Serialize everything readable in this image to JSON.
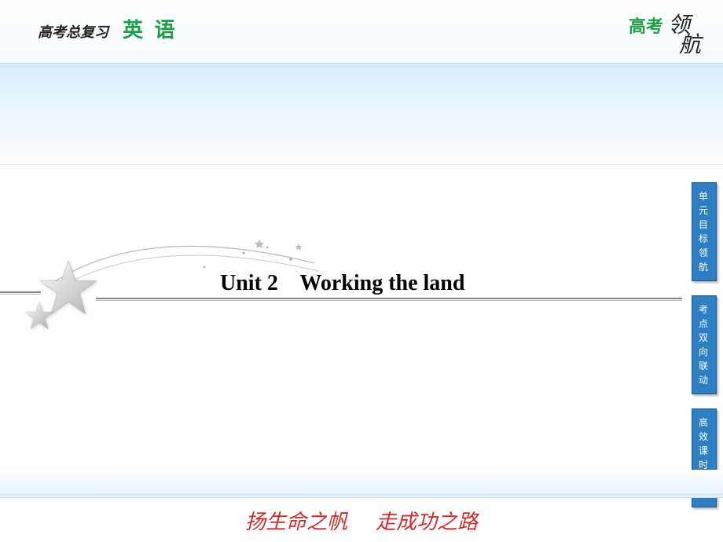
{
  "header": {
    "review_label": "高考总复习",
    "subject": "英 语",
    "gaokao": "高考",
    "linghang1": "领",
    "linghang2": "航"
  },
  "main": {
    "title": "Unit 2    Working the land"
  },
  "sidebar": {
    "tabs": [
      {
        "label": "单元目标领航"
      },
      {
        "label": "考点双向联动"
      },
      {
        "label": "高效课时作业"
      }
    ]
  },
  "footer": {
    "left": "扬生命之帆",
    "right": "走成功之路"
  }
}
